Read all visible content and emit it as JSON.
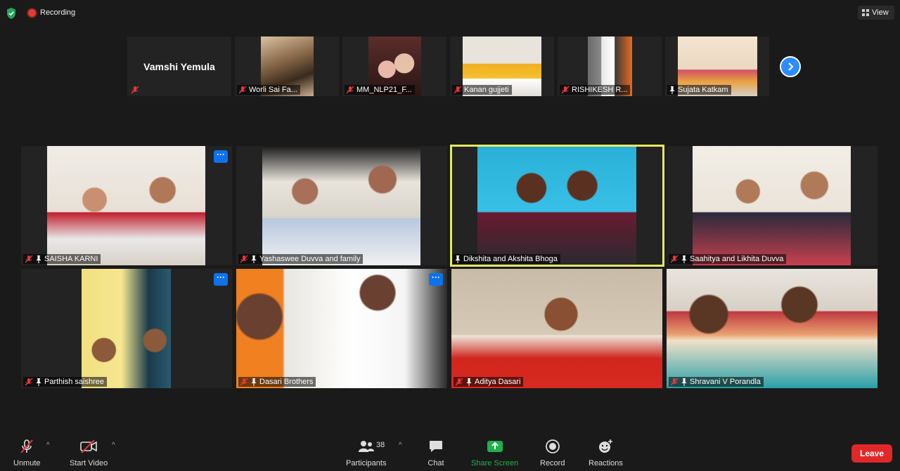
{
  "top_bar": {
    "recording_label": "Recording",
    "view_label": "View",
    "accent_color": "#2d8cff",
    "recording_color": "#e53935"
  },
  "thumbnails": [
    {
      "name": "Vamshi Yemula",
      "video": false,
      "mic_muted": true
    },
    {
      "name": "Worli Sai Fa...",
      "video": true,
      "mic_muted": true
    },
    {
      "name": "MM_NLP21_F...",
      "video": true,
      "mic_muted": true
    },
    {
      "name": "Kanan gujjeti",
      "video": true,
      "mic_muted": true
    },
    {
      "name": "RISHIKESH R...",
      "video": true,
      "mic_muted": true
    },
    {
      "name": "Sujata Katkam",
      "video": true,
      "mic_muted": false
    }
  ],
  "tiles": [
    {
      "name": "SAISHA KARNI",
      "mic_muted": true,
      "pinned": true,
      "more": true,
      "active": false
    },
    {
      "name": "Yashaswee Duvva and family",
      "mic_muted": true,
      "pinned": true,
      "more": false,
      "active": false
    },
    {
      "name": "Dikshita and Akshita  Bhoga",
      "mic_muted": false,
      "pinned": true,
      "more": false,
      "active": true
    },
    {
      "name": "Saahitya and Likhita Duvva",
      "mic_muted": true,
      "pinned": true,
      "more": false,
      "active": false
    },
    {
      "name": "Parthish saishree",
      "mic_muted": true,
      "pinned": true,
      "more": true,
      "active": false
    },
    {
      "name": "Dasari Brothers",
      "mic_muted": true,
      "pinned": true,
      "more": true,
      "active": false
    },
    {
      "name": "Aditya Dasari",
      "mic_muted": true,
      "pinned": true,
      "more": false,
      "active": false
    },
    {
      "name": "Shravani V Porandla",
      "mic_muted": true,
      "pinned": true,
      "more": false,
      "active": false
    }
  ],
  "more_label": "···",
  "toolbar": {
    "unmute_label": "Unmute",
    "start_video_label": "Start Video",
    "participants_label": "Participants",
    "participants_count": "38",
    "chat_label": "Chat",
    "share_screen_label": "Share Screen",
    "record_label": "Record",
    "reactions_label": "Reactions",
    "leave_label": "Leave",
    "caret": "^",
    "share_color": "#21b04b",
    "leave_color": "#e02828"
  }
}
